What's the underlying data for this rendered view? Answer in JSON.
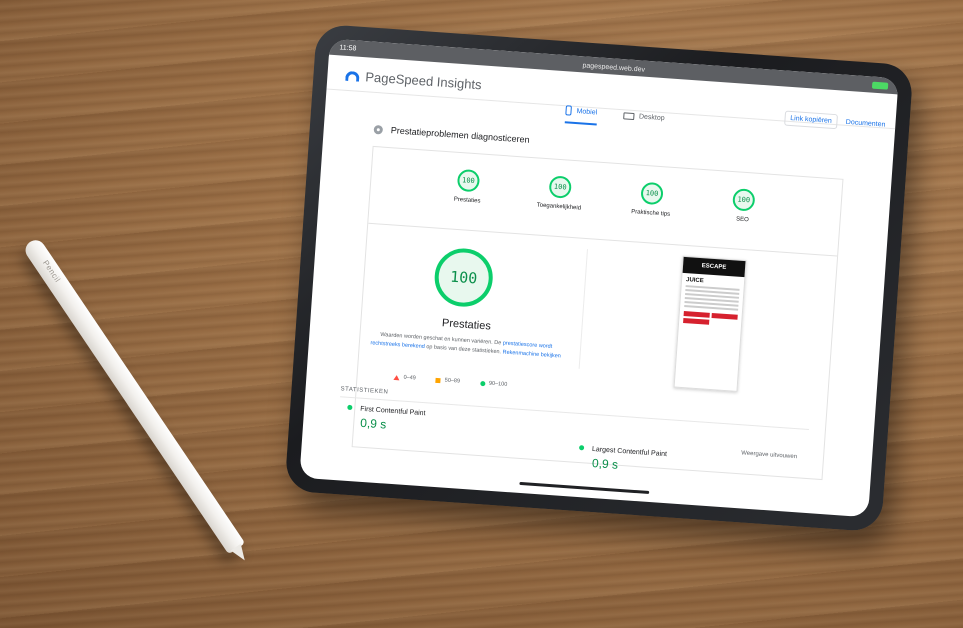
{
  "status": {
    "time": "11:58",
    "url": "pagespeed.web.dev"
  },
  "header": {
    "logo": "PageSpeed Insights",
    "link_button": "Link kopiëren",
    "docs": "Documenten"
  },
  "tabs": [
    {
      "label": "Mobiel"
    },
    {
      "label": "Desktop"
    }
  ],
  "diagnose": {
    "title": "Prestatieproblemen diagnosticeren"
  },
  "scores": [
    {
      "value": "100",
      "label": "Prestaties"
    },
    {
      "value": "100",
      "label": "Toegankelijkheid"
    },
    {
      "value": "100",
      "label": "Praktische tips"
    },
    {
      "value": "100",
      "label": "SEO"
    }
  ],
  "performance": {
    "score": "100",
    "title": "Prestaties",
    "desc_1": "Waarden worden geschat en kunnen variëren. De ",
    "desc_link_1": "prestatiescore wordt rechtstreeks berekend",
    "desc_2": " op basis van deze statistieken. ",
    "desc_link_2": "Rekenmachine bekijken",
    "legend": [
      "0–49",
      "50–89",
      "90–100"
    ]
  },
  "preview": {
    "brand": "ESCAPE",
    "heading": "JUICE",
    "buttons": 3
  },
  "stats": {
    "heading": "STATISTIEKEN",
    "expand": "Weergave uitvouwen",
    "fcp_label": "First Contentful Paint",
    "fcp_value": "0,9 s",
    "lcp_label": "Largest Contentful Paint",
    "lcp_value": "0,9 s"
  },
  "pencil": {
    "brand": "Pencil"
  },
  "colors": {
    "pass": "#0cce6b",
    "average": "#ffa400",
    "fail": "#ff4e42",
    "link": "#1a73e8"
  }
}
